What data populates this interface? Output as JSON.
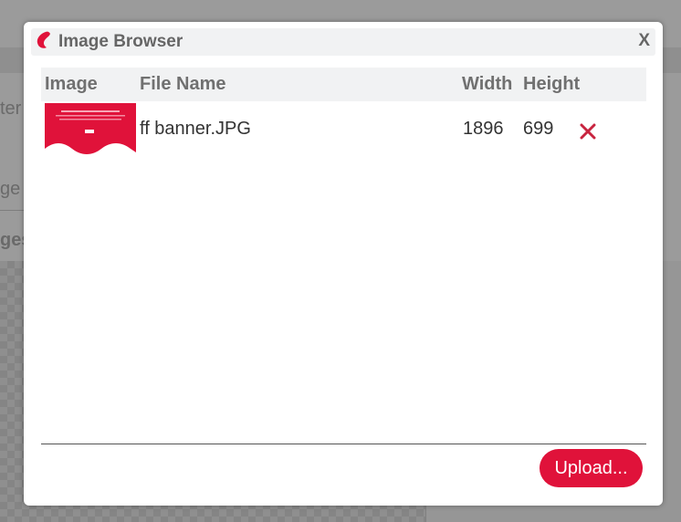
{
  "background": {
    "partial_text_1": "ter",
    "partial_text_2": "ge",
    "partial_text_3": "ges"
  },
  "dialog": {
    "title": "Image Browser",
    "close_label": "X",
    "logo_icon": "red-brand-drop-icon",
    "accent_color": "#e0123a"
  },
  "table": {
    "headers": {
      "image": "Image",
      "file_name": "File Name",
      "width": "Width",
      "height": "Height"
    },
    "rows": [
      {
        "file_name": "ff banner.JPG",
        "width": "1896",
        "height": "699",
        "delete_icon": "delete-x-icon"
      }
    ]
  },
  "footer": {
    "upload_label": "Upload..."
  }
}
